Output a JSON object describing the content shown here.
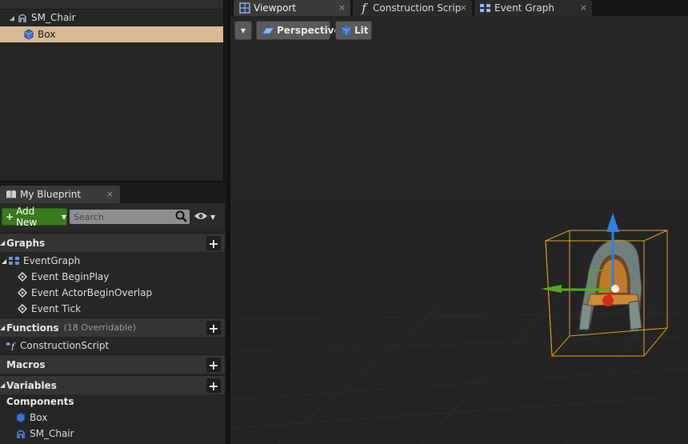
{
  "components_panel": {
    "tree": [
      {
        "label": "SM_Chair",
        "icon": "static-mesh-icon",
        "expanded": true,
        "selected": false
      },
      {
        "label": "Box",
        "icon": "box-collision-icon",
        "selected": true
      }
    ]
  },
  "my_blueprint": {
    "tab_label": "My Blueprint",
    "close": "×",
    "add_new_label": "Add New",
    "search_placeholder": "Search",
    "sections": {
      "graphs": {
        "label": "Graphs",
        "items": [
          "EventGraph",
          "Event BeginPlay",
          "Event ActorBeginOverlap",
          "Event Tick"
        ]
      },
      "functions": {
        "label": "Functions",
        "sub": "(18 Overridable)",
        "items": [
          "ConstructionScript"
        ]
      },
      "macros": {
        "label": "Macros"
      },
      "variables": {
        "label": "Variables"
      },
      "components": {
        "label": "Components",
        "items": [
          "Box",
          "SM_Chair"
        ]
      }
    }
  },
  "editor_tabs": [
    {
      "label": "Viewport",
      "icon": "viewport-icon",
      "active": true
    },
    {
      "label": "Construction Scrip",
      "icon": "function-icon",
      "active": false
    },
    {
      "label": "Event Graph",
      "icon": "event-graph-icon",
      "active": false
    }
  ],
  "viewport_toolbar": {
    "perspective_label": "Perspective",
    "lit_label": "Lit"
  },
  "colors": {
    "selection": "#d8b994",
    "add_new": "#3a7a1e",
    "bounds": "#e0a020",
    "gizmo_x": "#d62a1a",
    "gizmo_y": "#5aa81a",
    "gizmo_z": "#2f7fdc"
  }
}
